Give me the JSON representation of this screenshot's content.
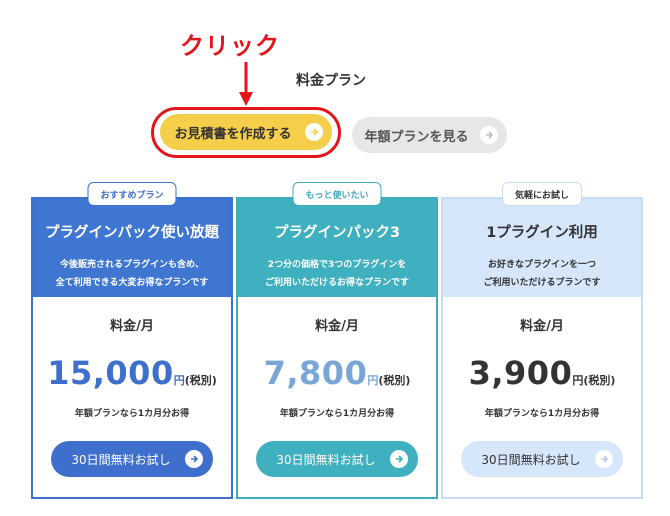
{
  "annotation": {
    "label": "クリック",
    "color": "#e3141b"
  },
  "page_title": "料金プラン",
  "buttons": {
    "quote": "お見積書を作成する",
    "annual": "年額プランを見る"
  },
  "plans": [
    {
      "badge": "おすすめプラン",
      "title": "プラグインパック使い放題",
      "desc_line1": "今後販売されるプラグインも含め、",
      "desc_line2": "全て利用できる大変お得なプランです",
      "price_label": "料金/月",
      "price": "15,000",
      "unit": "円",
      "tax": "(税別)",
      "note": "年額プランなら1カ月分お得",
      "cta": "30日間無料お試し",
      "accent": "#3f6fcc"
    },
    {
      "badge": "もっと使いたい",
      "title": "プラグインパック3",
      "desc_line1": "2つ分の価格で3つのプラグインを",
      "desc_line2": "ご利用いただけるお得なプランです",
      "price_label": "料金/月",
      "price": "7,800",
      "unit": "円",
      "tax": "(税別)",
      "note": "年額プランなら1カ月分お得",
      "cta": "30日間無料お試し",
      "accent": "#3fabbc"
    },
    {
      "badge": "気軽にお試し",
      "title": "1プラグイン利用",
      "desc_line1": "お好きなプラグインを一つ",
      "desc_line2": "ご利用いただけるプランです",
      "price_label": "料金/月",
      "price": "3,900",
      "unit": "円",
      "tax": "(税別)",
      "note": "年額プランなら1カ月分お得",
      "cta": "30日間無料お試し",
      "accent": "#c9dcf7"
    }
  ]
}
